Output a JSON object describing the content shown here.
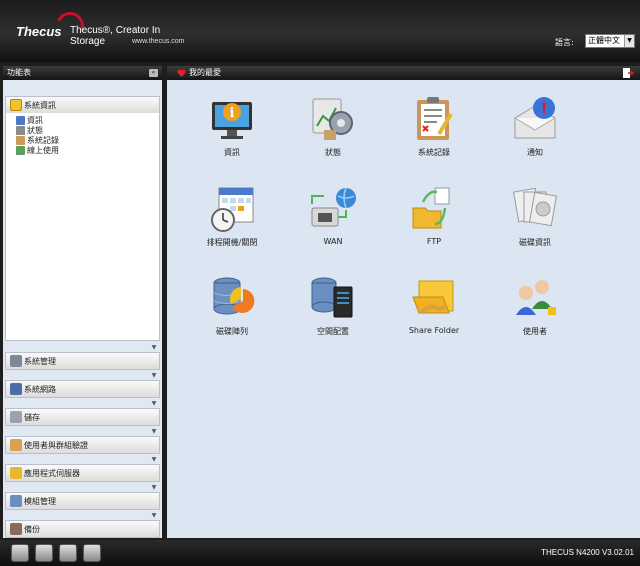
{
  "header": {
    "brand": "Thecus",
    "slogan": "Thecus®, Creator In Storage",
    "url": "www.thecus.com",
    "language_label": "語言:",
    "language_value": "正體中文"
  },
  "sidebar": {
    "title": "功能表",
    "open_section": {
      "label": "系統資訊",
      "items": [
        "資訊",
        "狀態",
        "系統記錄",
        "線上使用"
      ]
    },
    "sections": [
      "系統管理",
      "系統網路",
      "儲存",
      "使用者與群組驗證",
      "應用程式伺服器",
      "模組管理",
      "備份"
    ]
  },
  "main": {
    "title": "我的最愛",
    "apps": [
      {
        "label": "資訊",
        "icon": "monitor-info-icon"
      },
      {
        "label": "狀態",
        "icon": "status-gear-icon"
      },
      {
        "label": "系統記錄",
        "icon": "clipboard-log-icon"
      },
      {
        "label": "通知",
        "icon": "mail-alert-icon"
      },
      {
        "label": "排程開機/關閉",
        "icon": "calendar-clock-icon"
      },
      {
        "label": "WAN",
        "icon": "network-globe-icon"
      },
      {
        "label": "FTP",
        "icon": "folder-transfer-icon"
      },
      {
        "label": "磁碟資訊",
        "icon": "disks-icon"
      },
      {
        "label": "磁碟陣列",
        "icon": "raid-pie-icon"
      },
      {
        "label": "空間配置",
        "icon": "space-allocation-icon"
      },
      {
        "label": "Share Folder",
        "icon": "share-folder-icon"
      },
      {
        "label": "使用者",
        "icon": "users-icon"
      }
    ]
  },
  "footer": {
    "version": "THECUS N4200 V3.02.01"
  },
  "colors": {
    "header_bg": "#1c1c1c",
    "panel_bg": "#dce6f2",
    "accent_red": "#c8102e"
  }
}
